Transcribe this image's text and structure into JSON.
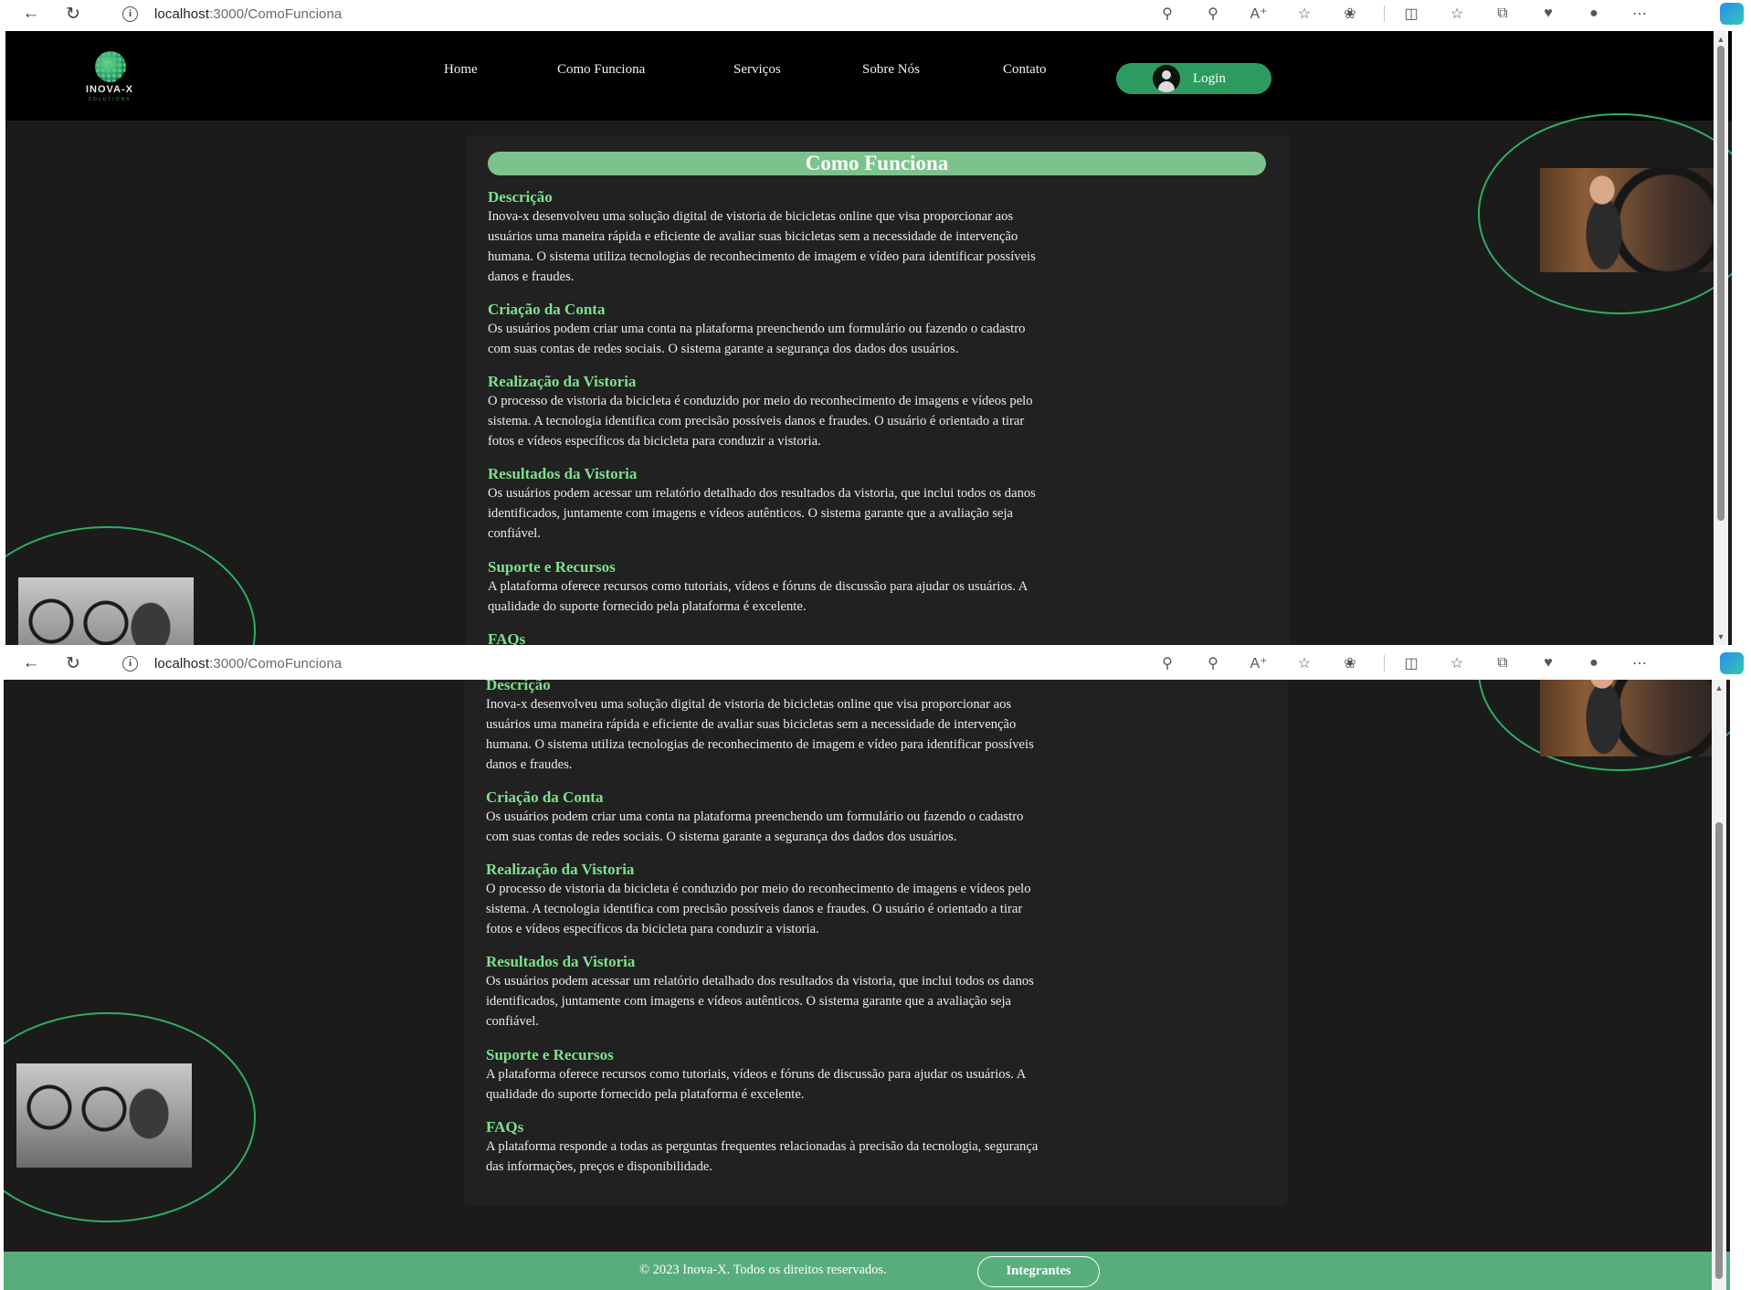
{
  "browser": {
    "url_host": "localhost",
    "url_path": ":3000/ComoFunciona"
  },
  "header": {
    "logo_name": "INOVA-X",
    "logo_sub": "SOLUTIONS",
    "nav": [
      "Home",
      "Como Funciona",
      "Serviços",
      "Sobre Nós",
      "Contato"
    ],
    "login_label": "Login"
  },
  "content": {
    "title": "Como Funciona",
    "sections": [
      {
        "heading": "Descrição",
        "lines": [
          "Inova-x desenvolveu uma solução digital de vistoria de bicicletas online que visa proporcionar aos",
          "usuários uma maneira rápida e eficiente de avaliar suas bicicletas sem a necessidade de intervenção",
          "humana. O sistema utiliza tecnologias de reconhecimento de imagem e vídeo para identificar possíveis",
          "danos e fraudes."
        ]
      },
      {
        "heading": "Criação da Conta",
        "lines": [
          "Os usuários podem criar uma conta na plataforma preenchendo um formulário ou fazendo o cadastro",
          "com suas contas de redes sociais. O sistema garante a segurança dos dados dos usuários."
        ]
      },
      {
        "heading": "Realização da Vistoria",
        "lines": [
          "O processo de vistoria da bicicleta é conduzido por meio do reconhecimento de imagens e vídeos pelo",
          "sistema. A tecnologia identifica com precisão possíveis danos e fraudes. O usuário é orientado a tirar",
          "fotos e vídeos específicos da bicicleta para conduzir a vistoria."
        ]
      },
      {
        "heading": "Resultados da Vistoria",
        "lines": [
          "Os usuários podem acessar um relatório detalhado dos resultados da vistoria, que inclui todos os danos",
          "identificados, juntamente com imagens e vídeos autênticos. O sistema garante que a avaliação seja",
          "confiável."
        ]
      },
      {
        "heading": "Suporte e Recursos",
        "lines": [
          "A plataforma oferece recursos como tutoriais, vídeos e fóruns de discussão para ajudar os usuários. A",
          "qualidade do suporte fornecido pela plataforma é excelente."
        ]
      },
      {
        "heading": "FAQs",
        "lines": [
          "A plataforma responde a todas as perguntas frequentes relacionadas à precisão da tecnologia, segurança",
          "das informações, preços e disponibilidade."
        ]
      }
    ]
  },
  "footer": {
    "copyright": "© 2023 Inova-X. Todos os direitos reservados.",
    "integrantes_label": "Integrantes"
  },
  "colors": {
    "accent": "#2d9b5f",
    "heading": "#7ee08c",
    "title_bar": "#7cc28c",
    "footer": "#58ad7c",
    "page_bg": "#1b1b1b"
  }
}
